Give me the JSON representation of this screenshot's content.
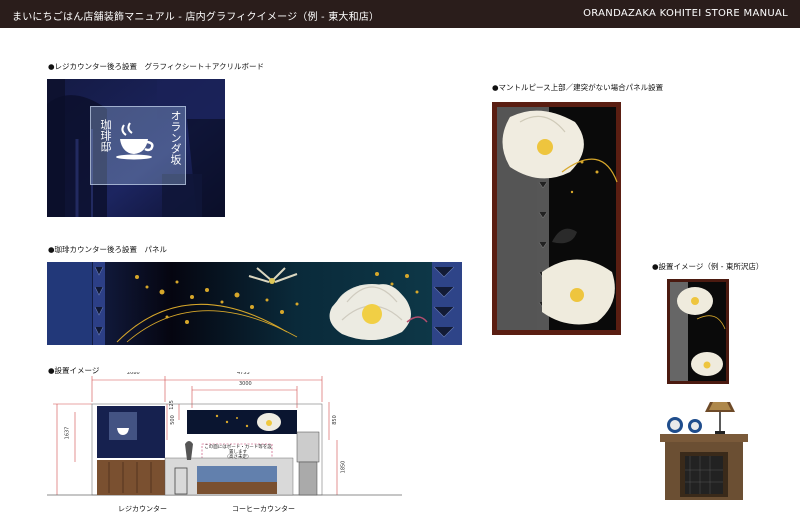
{
  "header": {
    "title": "まいにちごはん店舗装飾マニュアル - 店内グラフィクイメージ（例 - 東大和店）",
    "brand": "ORANDAZAKA KOHITEI STORE MANUAL"
  },
  "sections": {
    "register": "●レジカウンター後ろ設置　グラフィクシート＋アクリルボード",
    "coffee": "●珈琲カウンター後ろ設置　パネル",
    "install": "●設置イメージ",
    "mantel": "●マントルピース上部／建突がない場合パネル設置",
    "mantel_example": "●設置イメージ（例 - 東所沢店）"
  },
  "sign": {
    "line1": "オランダ坂",
    "line2": "珈琲邸"
  },
  "install": {
    "dim_2080": "2080",
    "dim_4753": "4753",
    "dim_3000": "3000",
    "dim_2700": "2700",
    "dim_1637": "1637",
    "dim_125": "125",
    "dim_500": "500",
    "dim_850": "850",
    "dim_1850": "1850",
    "note_line1": "この面にはボード・カード等を設置します",
    "note_line2": "（高さ未定）",
    "label_register": "レジカウンター",
    "label_coffee": "コーヒーカウンター"
  }
}
